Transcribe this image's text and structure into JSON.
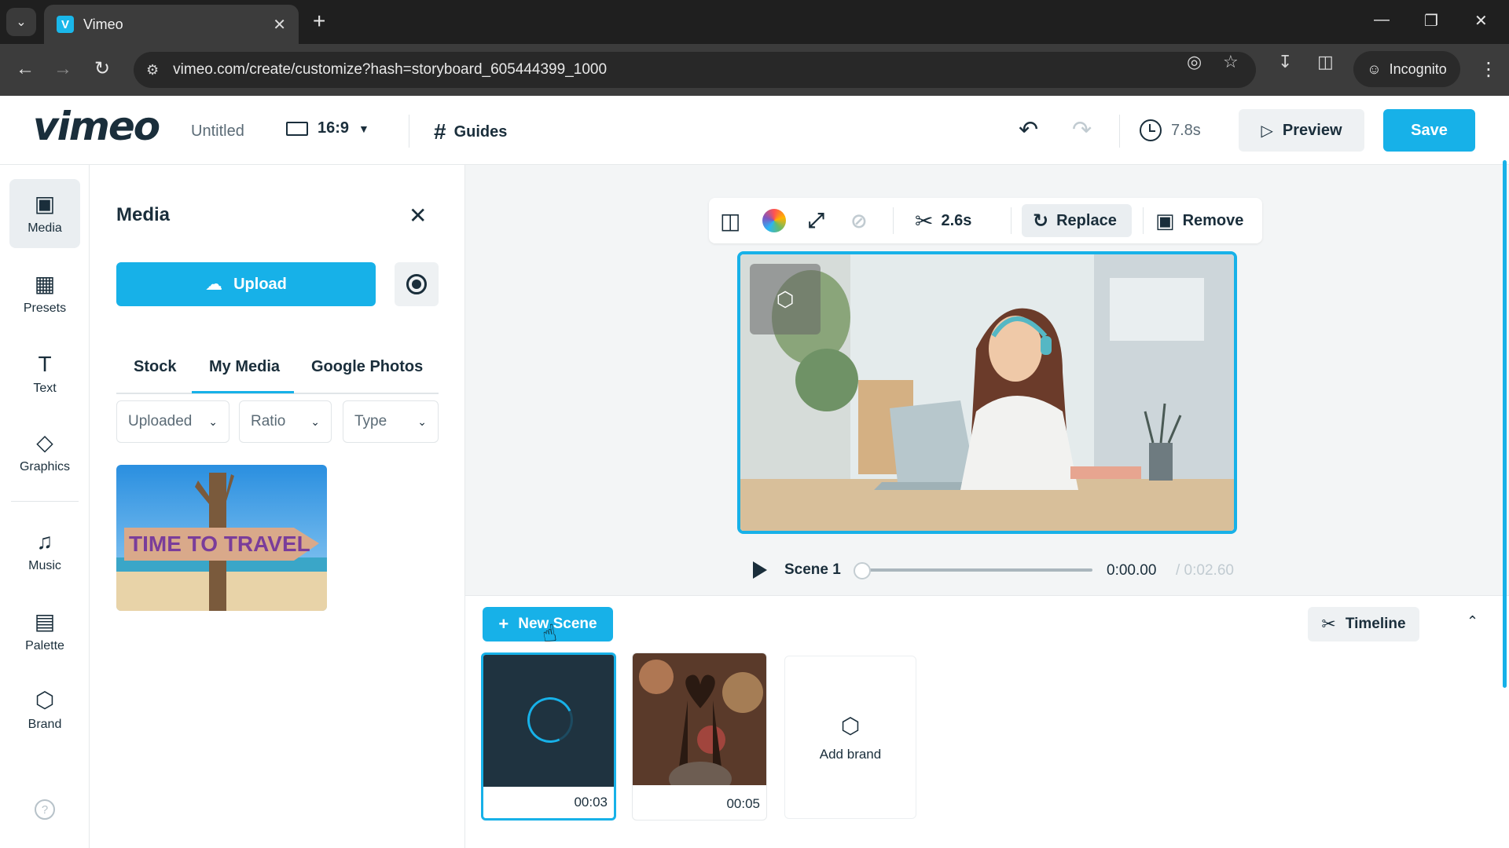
{
  "browser": {
    "tab_title": "Vimeo",
    "url": "vimeo.com/create/customize?hash=storyboard_605444399_1000",
    "incognito_label": "Incognito"
  },
  "header": {
    "logo": "vimeo",
    "doc_title": "Untitled",
    "ratio": "16:9",
    "guides_label": "Guides",
    "duration": "7.8s",
    "preview_label": "Preview",
    "save_label": "Save"
  },
  "rail": {
    "items": [
      {
        "label": "Media",
        "icon": "image-icon"
      },
      {
        "label": "Presets",
        "icon": "grid-icon"
      },
      {
        "label": "Text",
        "icon": "text-icon"
      },
      {
        "label": "Graphics",
        "icon": "shapes-icon"
      },
      {
        "label": "Music",
        "icon": "music-icon"
      },
      {
        "label": "Palette",
        "icon": "palette-icon"
      },
      {
        "label": "Brand",
        "icon": "brand-icon"
      }
    ]
  },
  "media_panel": {
    "title": "Media",
    "upload_label": "Upload",
    "tabs": [
      "Stock",
      "My Media",
      "Google Photos"
    ],
    "active_tab": "My Media",
    "filters": [
      "Uploaded",
      "Ratio",
      "Type"
    ],
    "thumbnail_text": "TIME TO TRAVEL"
  },
  "toolbar": {
    "trim_duration": "2.6s",
    "replace_label": "Replace",
    "remove_label": "Remove"
  },
  "player": {
    "scene_label": "Scene 1",
    "current_time": "0:00.00",
    "total_time": "/ 0:02.60",
    "progress": 0
  },
  "scenes": {
    "new_scene_label": "New Scene",
    "timeline_label": "Timeline",
    "add_brand_label": "Add brand",
    "cards": [
      {
        "duration": "00:03",
        "selected": true
      },
      {
        "duration": "00:05",
        "selected": false
      }
    ]
  },
  "colors": {
    "accent": "#17b1e8",
    "text": "#1a2e3b"
  }
}
